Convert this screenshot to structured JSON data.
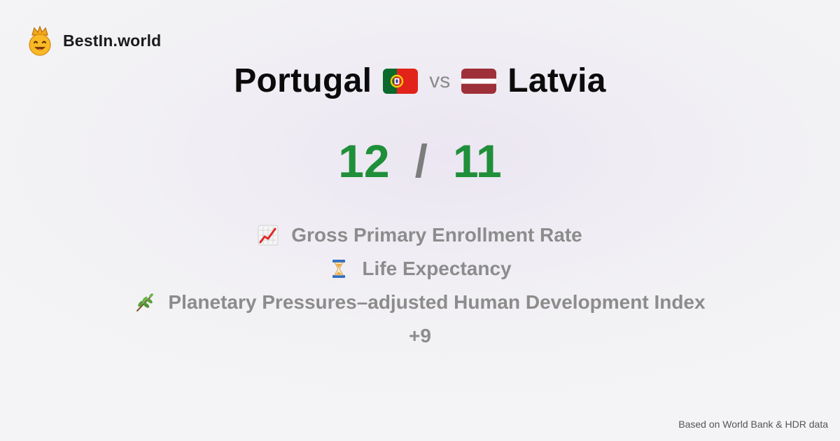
{
  "brand": {
    "name": "BestIn.world",
    "logo_icon": "smiling-crown-face-icon"
  },
  "comparison": {
    "left": {
      "name": "Portugal",
      "flag_icon": "portugal-flag-icon"
    },
    "vs_label": "vs",
    "right": {
      "name": "Latvia",
      "flag_icon": "latvia-flag-icon"
    }
  },
  "score": {
    "left": "12",
    "separator": "/",
    "right": "11",
    "color": "#1f8f3a"
  },
  "metrics": [
    {
      "icon": "chart-increasing-icon",
      "label": "Gross Primary Enrollment Rate"
    },
    {
      "icon": "hourglass-icon",
      "label": "Life Expectancy"
    },
    {
      "icon": "herb-icon",
      "label": "Planetary Pressures–adjusted Human Development Index"
    }
  ],
  "more_label": "+9",
  "footer": {
    "source": "Based on World Bank & HDR data"
  }
}
